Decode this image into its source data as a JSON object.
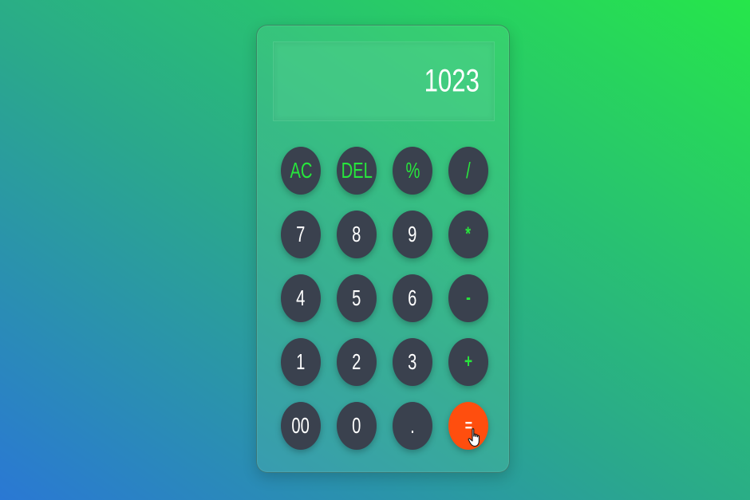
{
  "display": {
    "value": "1023"
  },
  "keys": [
    [
      "AC",
      "DEL",
      "%",
      "/"
    ],
    [
      "7",
      "8",
      "9",
      "*"
    ],
    [
      "4",
      "5",
      "6",
      "-"
    ],
    [
      "1",
      "2",
      "3",
      "+"
    ],
    [
      "00",
      "0",
      ".",
      "="
    ]
  ],
  "colors": {
    "key_bg": "#3a414e",
    "accent": "#27e63c",
    "equals_bg": "#ff4e0e",
    "digit_text": "#ffffff"
  }
}
